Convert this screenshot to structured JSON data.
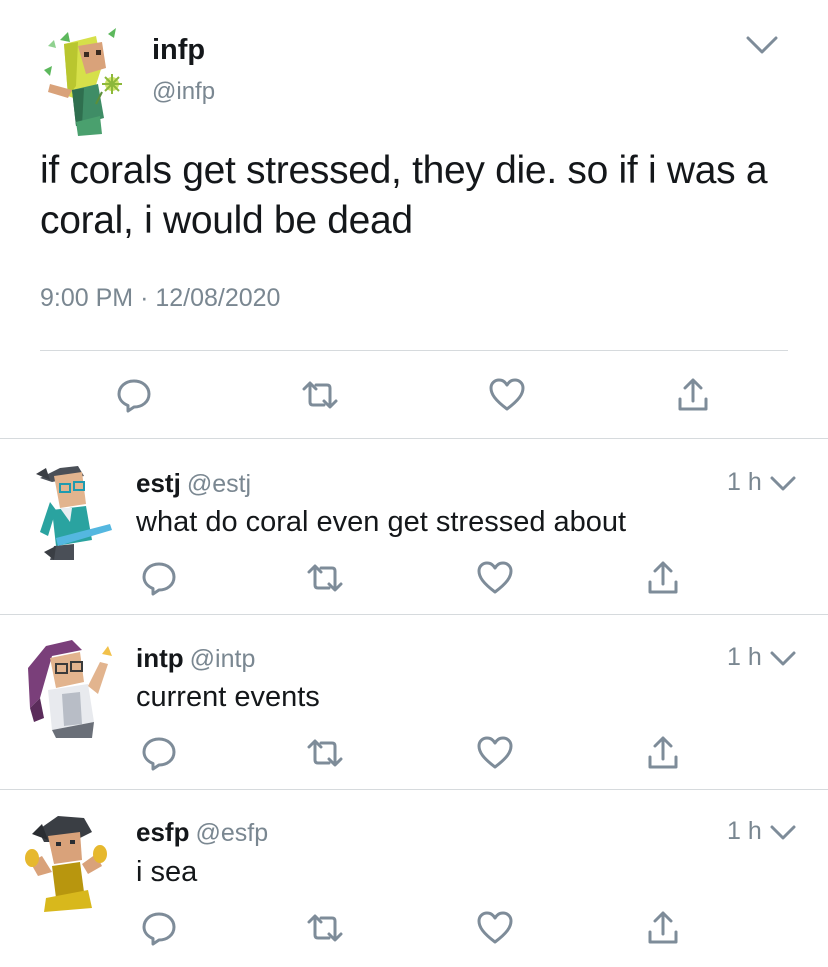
{
  "main_tweet": {
    "name": "infp",
    "handle": "@infp",
    "text": "if corals get stressed, they die. so if i was a coral, i would be dead",
    "time": "9:00 PM",
    "separator": "·",
    "date": "12/08/2020",
    "avatar_icon": "infp-character-avatar-icon",
    "menu_icon": "chevron-down-icon"
  },
  "replies": [
    {
      "name": "estj",
      "handle": "@estj",
      "text": "what do coral even get stressed about",
      "time": "1 h"
    },
    {
      "name": "intp",
      "handle": "@intp",
      "text": "current events",
      "time": "1 h"
    },
    {
      "name": "esfp",
      "handle": "@esfp",
      "text": "i sea",
      "time": "1 h"
    }
  ],
  "actions": [
    "reply-icon",
    "retweet-icon",
    "like-icon",
    "share-icon"
  ],
  "colors": {
    "text": "#14171a",
    "secondary": "#7a8791",
    "icon": "#7e8c99",
    "divider": "#d6dadd"
  }
}
